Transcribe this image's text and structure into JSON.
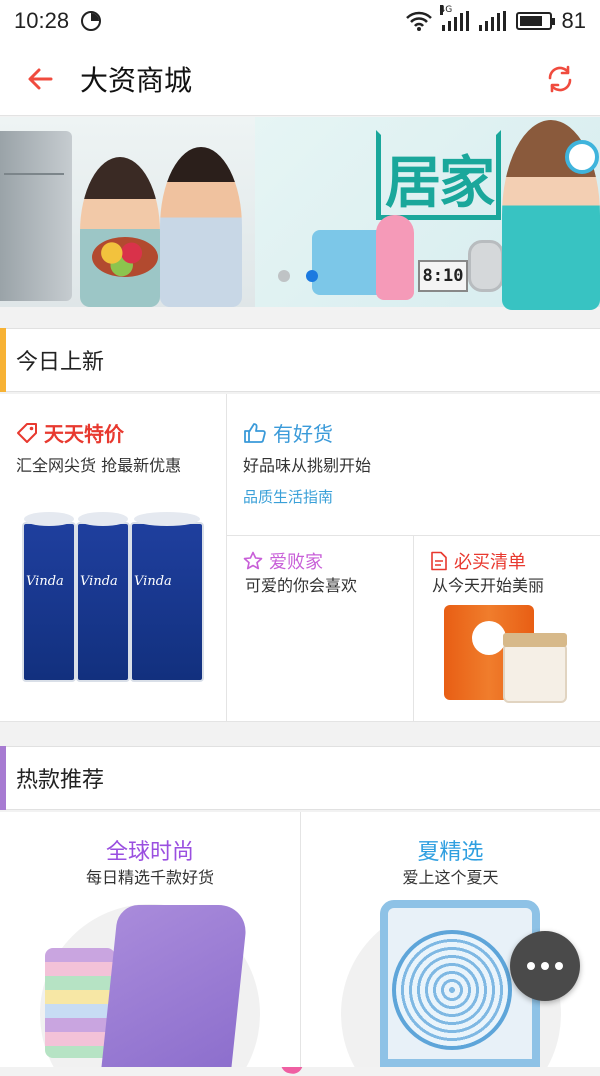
{
  "status_bar": {
    "time": "10:28",
    "battery_level": "81",
    "network": "4G"
  },
  "header": {
    "title": "大资商城",
    "back_icon": "arrow-left-icon",
    "refresh_icon": "refresh-icon",
    "accent": "#f04b3e"
  },
  "banner": {
    "headline": "居家",
    "lcd_time": "8:10",
    "slide_count": 2,
    "active_slide": 1
  },
  "section_new": {
    "label": "今日上新",
    "accent": "#f7b234"
  },
  "promo": {
    "daily_deals": {
      "title": "天天特价",
      "subtitle": "汇全网尖货 抢最新优惠",
      "color": "#e8392f"
    },
    "good_goods": {
      "title": "有好货",
      "subtitle": "好品味从挑剔开始",
      "link": "品质生活指南",
      "color": "#3a9ad9"
    },
    "love_home": {
      "title": "爱败家",
      "subtitle": "可爱的你会喜欢",
      "color": "#c85fd8"
    },
    "must_buy": {
      "title": "必买清单",
      "subtitle": "从今天开始美丽",
      "color": "#e8392f"
    }
  },
  "section_hot": {
    "label": "热款推荐",
    "accent": "#a77bd2"
  },
  "hot": {
    "global_fashion": {
      "title": "全球时尚",
      "subtitle": "每日精选千款好货",
      "color": "#9a4fe0"
    },
    "summer_pick": {
      "title": "夏精选",
      "subtitle": "爱上这个夏天",
      "color": "#2f9fe0"
    }
  },
  "fab": {
    "icon": "more-dots-icon"
  }
}
